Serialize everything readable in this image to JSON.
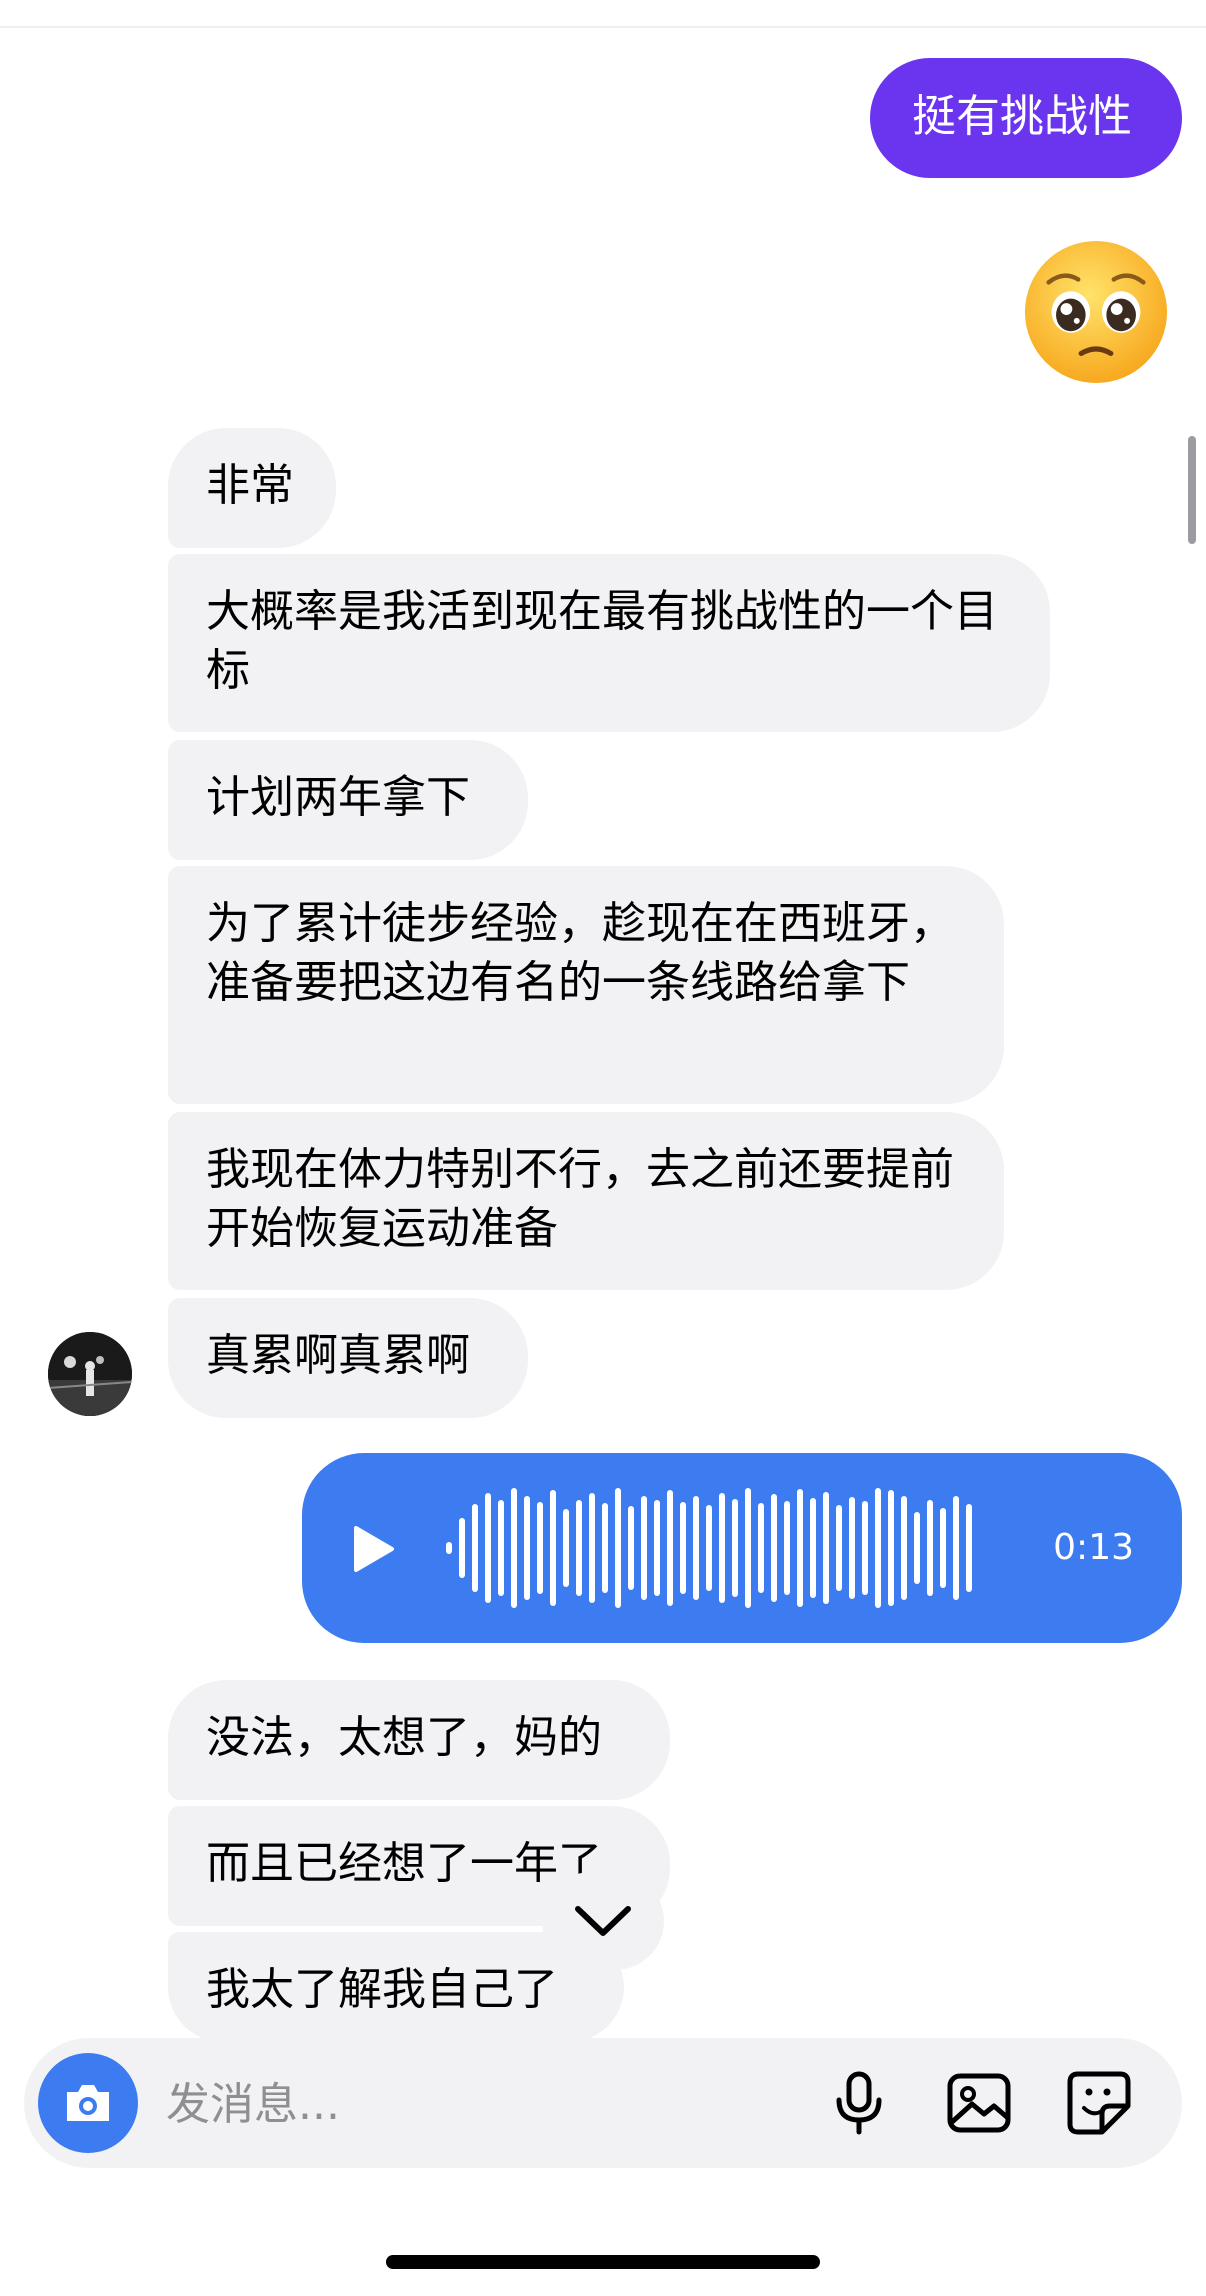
{
  "messages": {
    "outgoing_text": "挺有挑战性",
    "incoming": [
      "非常",
      "大概率是我活到现在最有挑战性的一个目标",
      "计划两年拿下",
      "为了累计徒步经验，趁现在在西班牙，准备要把这边有名的一条线路给拿下",
      "我现在体力特别不行，去之前还要提前开始恢复运动准备",
      "真累啊真累啊",
      "没法，太想了，妈的",
      "而且已经想了一年了",
      "我太了解我自己了"
    ],
    "voice": {
      "duration": "0:13"
    }
  },
  "composer": {
    "placeholder": "发消息..."
  },
  "colors": {
    "outgoing_bubble": "#6b35f0",
    "voice_bubble": "#3d7cf0",
    "incoming_bubble": "#f2f2f4"
  },
  "icons": {
    "composer": [
      "camera-icon",
      "microphone-icon",
      "image-icon",
      "sticker-icon"
    ],
    "scroll": "chevron-down-icon"
  }
}
